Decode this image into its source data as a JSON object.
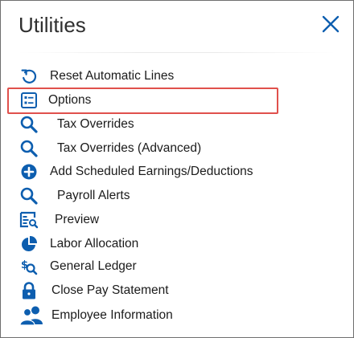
{
  "dialog": {
    "title": "Utilities",
    "close_icon": "close-icon"
  },
  "colors": {
    "accent": "#0d5eaf",
    "highlight_border": "#e0504c",
    "text": "#1b1b1b"
  },
  "items": [
    {
      "label": "Reset Automatic Lines",
      "icon": "reset-icon"
    },
    {
      "label": "Options",
      "icon": "options-list-icon",
      "highlighted": true
    },
    {
      "label": "Tax Overrides",
      "icon": "magnifier-icon"
    },
    {
      "label": "Tax Overrides (Advanced)",
      "icon": "magnifier-icon"
    },
    {
      "label": "Add Scheduled Earnings/Deductions",
      "icon": "add-circle-icon"
    },
    {
      "label": "Payroll Alerts",
      "icon": "magnifier-icon"
    },
    {
      "label": "Preview",
      "icon": "preview-icon"
    },
    {
      "label": "Labor Allocation",
      "icon": "pie-chart-icon"
    },
    {
      "label": "General Ledger",
      "icon": "ledger-search-icon"
    },
    {
      "label": "Close Pay Statement",
      "icon": "lock-icon"
    },
    {
      "label": "Employee Information",
      "icon": "people-icon"
    }
  ]
}
